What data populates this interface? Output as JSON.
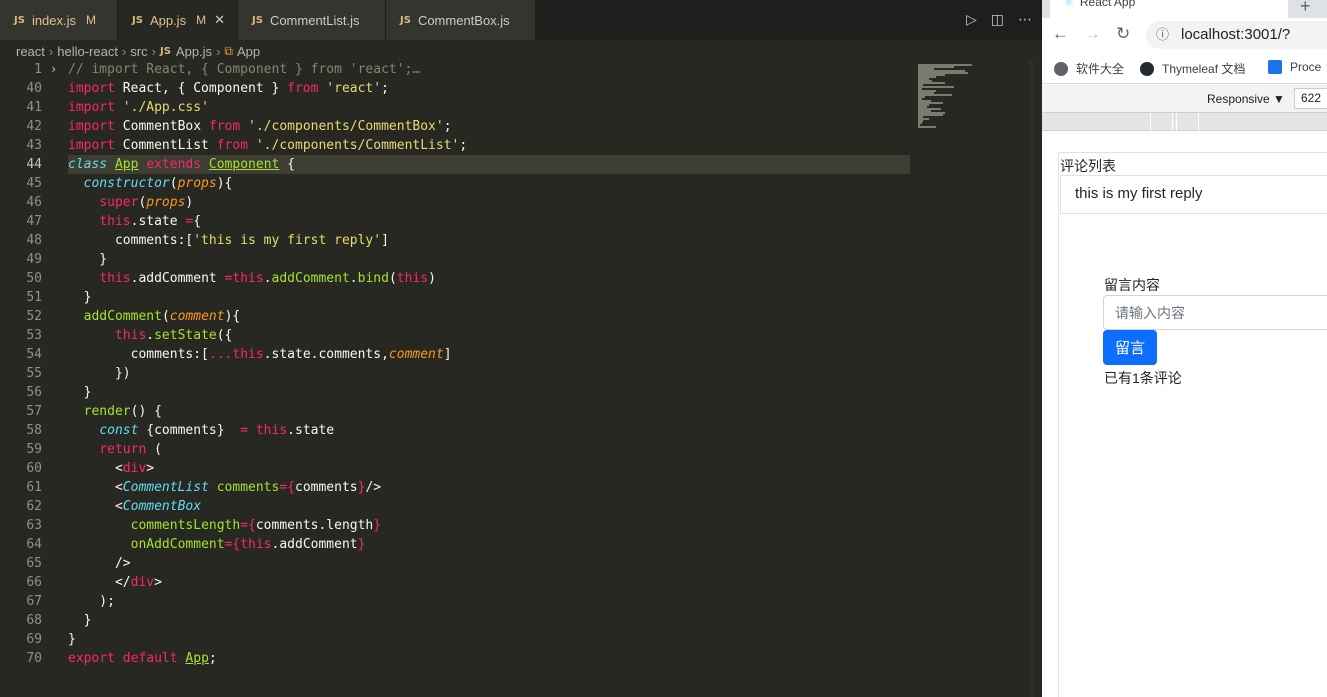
{
  "editor": {
    "tabs": [
      {
        "label": "index.js",
        "flag": "M",
        "lang": "JS"
      },
      {
        "label": "App.js",
        "flag": "M",
        "lang": "JS"
      },
      {
        "label": "CommentList.js",
        "flag": "",
        "lang": "JS"
      },
      {
        "label": "CommentBox.js",
        "flag": "",
        "lang": "JS"
      }
    ],
    "close_glyph": "✕",
    "breadcrumb": [
      "react",
      "hello-react",
      "src",
      "App.js",
      "App"
    ],
    "line_numbers": [
      "1",
      "40",
      "41",
      "42",
      "43",
      "44",
      "45",
      "46",
      "47",
      "48",
      "49",
      "50",
      "51",
      "52",
      "53",
      "54",
      "55",
      "56",
      "57",
      "58",
      "59",
      "60",
      "61",
      "62",
      "63",
      "64",
      "65",
      "66",
      "67",
      "68",
      "69",
      "70"
    ],
    "current_line": "44"
  },
  "browser": {
    "tab_title": "React App",
    "url": "localhost:3001/?",
    "bookmarks": [
      "软件大全",
      "Thymeleaf 文档",
      "Proce"
    ],
    "device_mode": "Responsive ▼",
    "width_value": "622",
    "page": {
      "list_title": "评论列表",
      "comments": [
        "this is my first reply"
      ],
      "input_label": "留言内容",
      "input_placeholder": "请输入内容",
      "submit_label": "留言",
      "count_text": "已有1条评论"
    }
  }
}
